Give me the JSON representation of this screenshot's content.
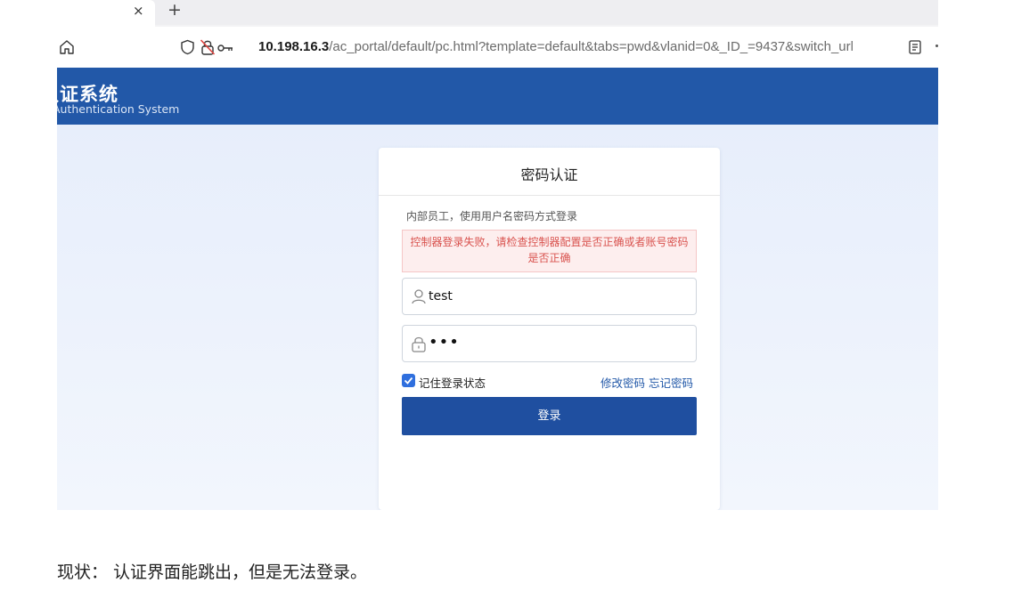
{
  "browser": {
    "tab_close": "×",
    "new_tab": "+",
    "url_host": "10.198.16.3",
    "url_path": "/ac_portal/default/pc.html?template=default&tabs=pwd&vlanid=0&_ID_=9437&switch_url"
  },
  "header": {
    "title": "认证系统",
    "subtitle": "Authentication System"
  },
  "login_card": {
    "title": "密码认证",
    "hint": "内部员工，使用用户名密码方式登录",
    "error": "控制器登录失败，请检查控制器配置是否正确或者账号密码是否正确",
    "username_value": "test",
    "password_value": "•••",
    "remember_label": "记住登录状态",
    "remember_checked": true,
    "change_password": "修改密码",
    "forgot_password": "忘记密码",
    "login_button": "登录"
  },
  "caption": "现状： 认证界面能跳出，但是无法登录。",
  "colors": {
    "header_blue": "#2258a8",
    "button_blue": "#1f4fa0",
    "error_red": "#d9534f",
    "error_bg": "#fdeeee"
  },
  "icons": [
    "home-icon",
    "shield-icon",
    "lock-icon",
    "key-icon",
    "reader-icon",
    "user-icon",
    "padlock-icon",
    "check-icon"
  ]
}
